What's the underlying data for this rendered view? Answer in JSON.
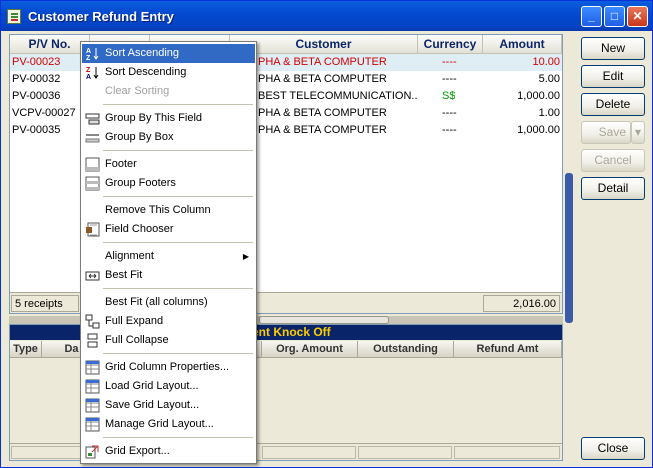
{
  "window": {
    "title": "Customer Refund Entry",
    "min": "_",
    "max": "□",
    "close": "✕"
  },
  "grid": {
    "headers": [
      "P/V No.",
      "",
      "",
      "Customer",
      "Currency",
      "Amount"
    ],
    "rows": [
      {
        "pv": "PV-00023",
        "customer": "PHA & BETA COMPUTER",
        "currency": "----",
        "amount": "10.00"
      },
      {
        "pv": "PV-00032",
        "customer": "PHA & BETA COMPUTER",
        "currency": "----",
        "amount": "5.00"
      },
      {
        "pv": "PV-00036",
        "customer": "BEST TELECOMMUNICATION...",
        "currency": "S$",
        "amount": "1,000.00"
      },
      {
        "pv": "VCPV-00027",
        "customer": "PHA & BETA COMPUTER",
        "currency": "----",
        "amount": "1.00"
      },
      {
        "pv": "PV-00035",
        "customer": "PHA & BETA COMPUTER",
        "currency": "----",
        "amount": "1,000.00"
      }
    ],
    "footer_count": "5 receipts",
    "footer_total": "2,016.00"
  },
  "knockoff": {
    "title": "ment Knock Off",
    "headers": [
      "Type",
      "Da",
      "Org. Amount",
      "Outstanding",
      "Refund Amt"
    ]
  },
  "buttons": {
    "new": "New",
    "edit": "Edit",
    "delete": "Delete",
    "save": "Save",
    "cancel": "Cancel",
    "detail": "Detail",
    "close": "Close"
  },
  "menu": {
    "sort_asc": "Sort Ascending",
    "sort_desc": "Sort Descending",
    "clear_sort": "Clear Sorting",
    "group_field": "Group By This Field",
    "group_box": "Group By Box",
    "footer": "Footer",
    "group_footers": "Group Footers",
    "remove_col": "Remove This Column",
    "field_chooser": "Field Chooser",
    "alignment": "Alignment",
    "best_fit": "Best Fit",
    "best_fit_all": "Best Fit (all columns)",
    "full_expand": "Full Expand",
    "full_collapse": "Full Collapse",
    "grid_props": "Grid Column Properties...",
    "load_layout": "Load Grid Layout...",
    "save_layout": "Save Grid Layout...",
    "manage_layout": "Manage Grid Layout...",
    "grid_export": "Grid Export..."
  }
}
